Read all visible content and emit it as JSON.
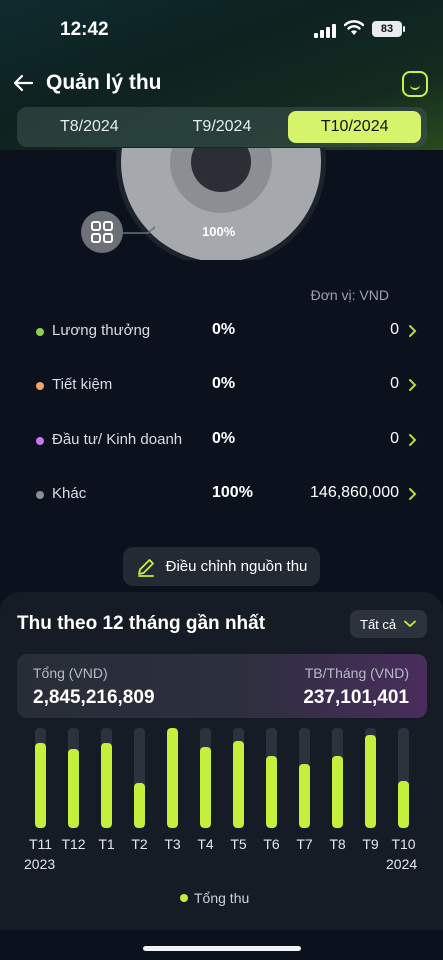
{
  "status_bar": {
    "time": "12:42",
    "battery": "83"
  },
  "header": {
    "title": "Quản lý thu"
  },
  "tabs": [
    {
      "label": "T8/2024",
      "active": false
    },
    {
      "label": "T9/2024",
      "active": false
    },
    {
      "label": "T10/2024",
      "active": true
    }
  ],
  "donut": {
    "label": "100%"
  },
  "unit_label": "Đơn vị: VND",
  "categories": [
    {
      "name": "Lương thưởng",
      "percent": "0%",
      "amount": "0",
      "color": "#8fd14f"
    },
    {
      "name": "Tiết kiệm",
      "percent": "0%",
      "amount": "0",
      "color": "#f2a56a"
    },
    {
      "name": "Đầu tư/ Kinh doanh",
      "percent": "0%",
      "amount": "0",
      "color": "#c879f0"
    },
    {
      "name": "Khác",
      "percent": "100%",
      "amount": "146,860,000",
      "color": "#8a8f95"
    }
  ],
  "adjust_button": {
    "label": "Điều chỉnh nguồn thu"
  },
  "summary": {
    "title": "Thu theo 12 tháng gần nhất",
    "filter": "Tất cả",
    "total_label": "Tổng (VND)",
    "total_value": "2,845,216,809",
    "avg_label": "TB/Tháng (VND)",
    "avg_value": "237,101,401"
  },
  "chart_data": {
    "type": "bar",
    "categories": [
      "T11",
      "T12",
      "T1",
      "T2",
      "T3",
      "T4",
      "T5",
      "T6",
      "T7",
      "T8",
      "T9",
      "T10"
    ],
    "values": [
      85,
      79,
      85,
      45,
      100,
      81,
      87,
      72,
      64,
      72,
      93,
      47
    ],
    "series": [
      {
        "name": "Tổng thu"
      }
    ],
    "year_start": "2023",
    "year_end": "2024",
    "accent": "#c5ef3d"
  }
}
